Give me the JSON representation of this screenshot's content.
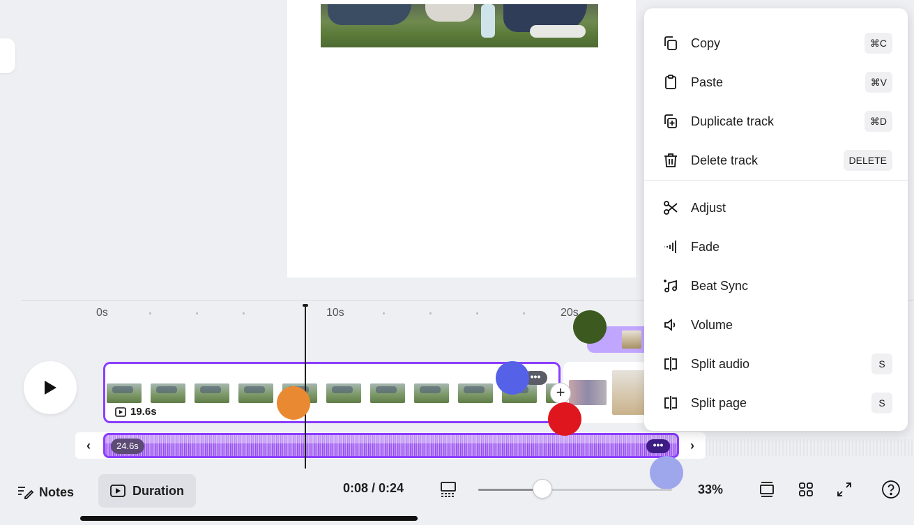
{
  "colors": {
    "accent": "#8b3dff",
    "dot_green": "#3c5a1f",
    "dot_blue": "#5561e6",
    "dot_orange": "#e98a33",
    "dot_red": "#e0161f",
    "dot_lavender": "#9ea6ec"
  },
  "timeline": {
    "ruler_labels": [
      "0s",
      "10s",
      "20s"
    ],
    "video_track": {
      "duration": "19.6s",
      "more": "•••"
    },
    "audio_track": {
      "duration": "24.6s",
      "more": "•••"
    },
    "nav_left": "‹",
    "nav_right": "›",
    "add": "+"
  },
  "bottom_bar": {
    "notes_label": "Notes",
    "duration_label": "Duration",
    "time": "0:08 / 0:24",
    "zoom_level": 0.33,
    "zoom_percent": "33%"
  },
  "context_menu": {
    "items": [
      {
        "label": "Copy",
        "shortcut": "⌘C",
        "icon": "copy-icon"
      },
      {
        "label": "Paste",
        "shortcut": "⌘V",
        "icon": "paste-icon"
      },
      {
        "label": "Duplicate track",
        "shortcut": "⌘D",
        "icon": "duplicate-icon"
      },
      {
        "label": "Delete track",
        "shortcut": "DELETE",
        "icon": "trash-icon"
      },
      {
        "label": "Adjust",
        "shortcut": "",
        "icon": "scissors-icon"
      },
      {
        "label": "Fade",
        "shortcut": "",
        "icon": "fade-icon"
      },
      {
        "label": "Beat Sync",
        "shortcut": "",
        "icon": "beat-sync-icon"
      },
      {
        "label": "Volume",
        "shortcut": "",
        "icon": "volume-icon"
      },
      {
        "label": "Split audio",
        "shortcut": "S",
        "icon": "split-icon"
      },
      {
        "label": "Split page",
        "shortcut": "S",
        "icon": "split-icon"
      }
    ]
  }
}
